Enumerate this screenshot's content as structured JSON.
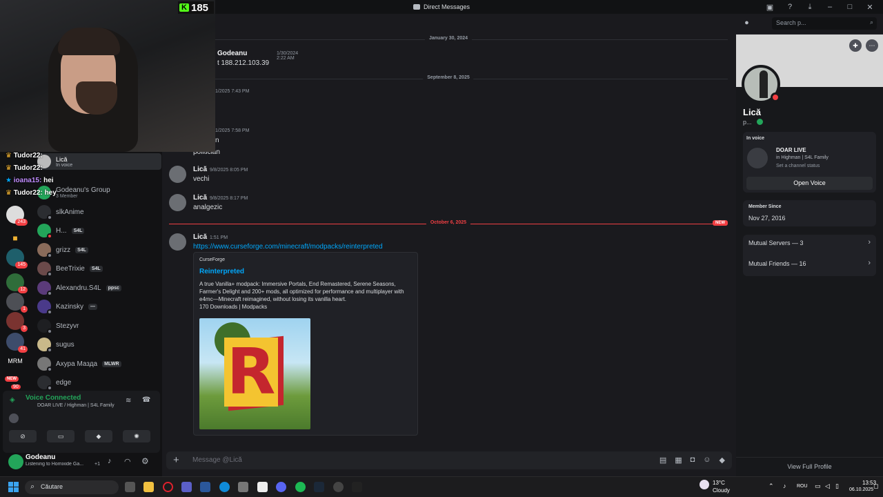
{
  "titlebar": {
    "title": "Direct Messages",
    "search_placeholder": "Search p..."
  },
  "overlay": {
    "sub_count": "185",
    "chat": [
      {
        "user": "Tudor22:",
        "msg": ""
      },
      {
        "user": "Tudor22:",
        "msg": ""
      },
      {
        "user": "ioana15:",
        "msg": "hei"
      },
      {
        "user": "Tudor22:",
        "msg": "hey"
      }
    ]
  },
  "rail": {
    "badges": [
      "243",
      "145",
      "12",
      "1",
      "3",
      "41"
    ],
    "mrm": "MRM",
    "new": "NEW",
    "bottom_badge": "90"
  },
  "dmlist": {
    "voice_row": {
      "name": "Lică",
      "status": "In voice"
    },
    "group": {
      "name": "Godeanu's Group",
      "sub": "3 Member"
    },
    "items": [
      {
        "name": "slkAnime",
        "tag": ""
      },
      {
        "name": "H...",
        "tag": "S4L"
      },
      {
        "name": "grizz",
        "tag": "S4L"
      },
      {
        "name": "BeeTrixie",
        "tag": "S4L"
      },
      {
        "name": "Alexandru.S4L",
        "tag": "ppsc"
      },
      {
        "name": "Kazinsky",
        "tag": "—"
      },
      {
        "name": "Stezyvr",
        "tag": ""
      },
      {
        "name": "sugus",
        "tag": ""
      },
      {
        "name": "Ахура Мазда",
        "tag": "MLWR"
      },
      {
        "name": "edge",
        "tag": ""
      }
    ]
  },
  "voice": {
    "status": "Voice Connected",
    "channel": "DOAR LIVE / Highman | S4L Family"
  },
  "user": {
    "name": "Godeanu",
    "activity": "Listening to Homixide Ga...",
    "extra": "+1"
  },
  "chat": {
    "dates": [
      "January 30, 2024",
      "September 8, 2025",
      "October 6, 2025"
    ],
    "new_label": "NEW",
    "msg1": {
      "name": "Godeanu",
      "time": "1/30/2024 2:22 AM",
      "text": "t 188.212.103.39"
    },
    "msg2": {
      "time": "1/2025 7:43 PM"
    },
    "msg3": {
      "time": "1/2025 7:58 PM",
      "line1": "n",
      "line2": "politician"
    },
    "msg4": {
      "name": "Lică",
      "time": "9/8/2025 8:05 PM",
      "text": "vechi"
    },
    "msg5": {
      "name": "Lică",
      "time": "9/8/2025 8:17 PM",
      "text": "analgezic"
    },
    "msg6": {
      "name": "Lică",
      "time": "1:51 PM",
      "link": "https://www.curseforge.com/minecraft/modpacks/reinterpreted"
    },
    "embed": {
      "provider": "CurseForge",
      "title": "Reinterpreted",
      "desc": "A true Vanilla+ modpack: Immersive Portals, End Remastered, Serene Seasons, Farmer's Delight and 200+ mods, all optimized for performance and multiplayer with e4mc—Minecraft reimagined, without losing its vanilla heart.",
      "stats": "170 Downloads | Modpacks",
      "image_letter": "R"
    },
    "composer_placeholder": "Message @Lică"
  },
  "profile": {
    "name": "Lică",
    "username": "p...",
    "in_voice_label": "In voice",
    "voice_channel": "DOAR LIVE",
    "voice_server": "in Highman | S4L Family",
    "set_status": "Set a channel status",
    "open_voice": "Open Voice",
    "member_since_label": "Member Since",
    "member_since": "Nov 27, 2016",
    "mutual_servers": "Mutual Servers — 3",
    "mutual_friends": "Mutual Friends — 16",
    "view_full": "View Full Profile"
  },
  "taskbar": {
    "search": "Căutare",
    "weather_temp": "13°C",
    "weather_desc": "Cloudy",
    "lang": "ROU",
    "time": "13:53",
    "date": "06.10.2025"
  },
  "colors": {
    "accent": "#5865f2",
    "link": "#00a8fc",
    "danger": "#f23f43",
    "online": "#23a55a"
  }
}
